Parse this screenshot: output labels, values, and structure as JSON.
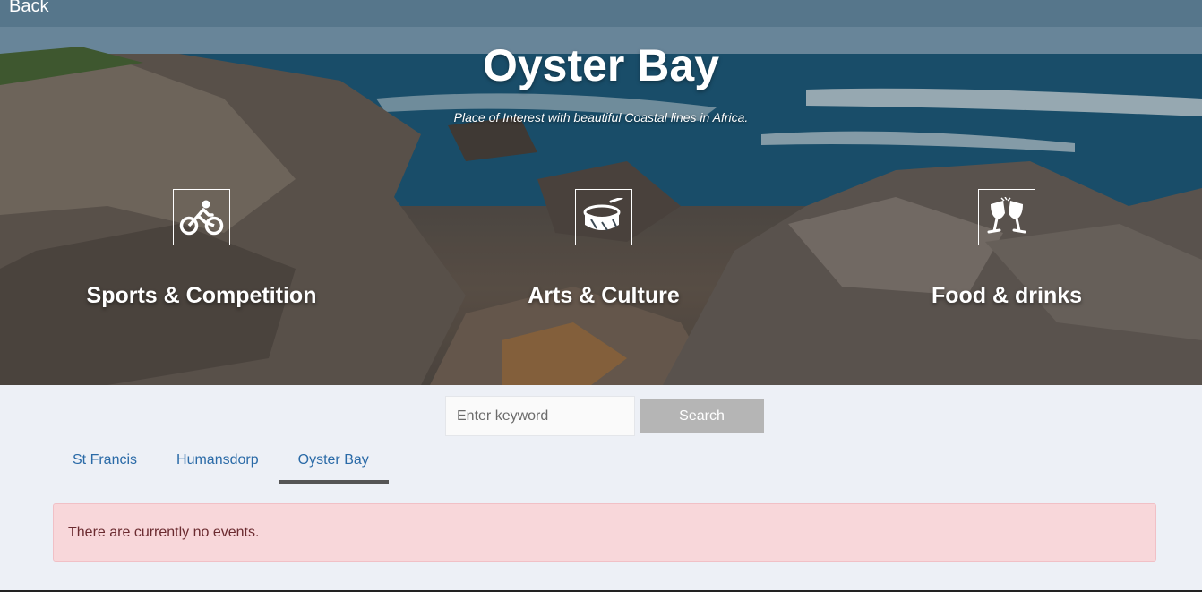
{
  "hero": {
    "back_label": "Back",
    "title": "Oyster Bay",
    "subtitle": "Place of Interest with beautiful Coastal lines in Africa."
  },
  "categories": [
    {
      "label": "Sports & Competition",
      "icon": "cyclist-icon"
    },
    {
      "label": "Arts & Culture",
      "icon": "drum-icon"
    },
    {
      "label": "Food & drinks",
      "icon": "wine-glasses-icon"
    }
  ],
  "search": {
    "placeholder": "Enter keyword",
    "value": "",
    "button_label": "Search"
  },
  "tabs": [
    {
      "label": "St Francis",
      "active": false
    },
    {
      "label": "Humansdorp",
      "active": false
    },
    {
      "label": "Oyster Bay",
      "active": true
    }
  ],
  "alert": {
    "message": "There are currently no events."
  },
  "colors": {
    "tab_link": "#2a6aa7",
    "tab_active_underline": "#555555",
    "alert_bg": "#f8d7da",
    "alert_text": "#6b2b30",
    "search_button_bg": "#b5b5b5",
    "page_bg": "#edf0f6"
  }
}
